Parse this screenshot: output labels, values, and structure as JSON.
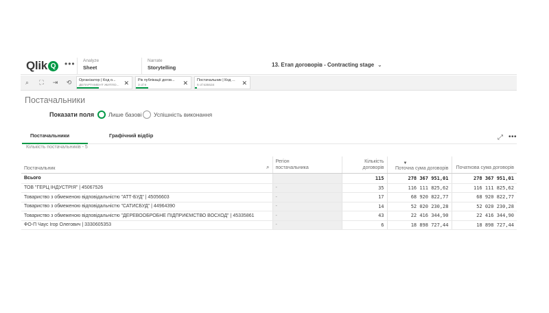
{
  "app": {
    "logo_text": "Qlik",
    "logo_badge": "Q",
    "menu_glyph": "•••",
    "nav": [
      {
        "sub": "Analyze",
        "main": "Sheet"
      },
      {
        "sub": "Narrate",
        "main": "Storytelling"
      }
    ],
    "sheet_title": "13. Етап договорів - Contracting stage",
    "chevron": "⌄"
  },
  "selections": {
    "tools": [
      "⌕",
      "⛶",
      "⇥",
      "⟲"
    ],
    "chips": [
      {
        "field": "Організатор | Код о...",
        "value": "ДЕПАРТАМЕНТ ЖИТЛО...",
        "clear": "✕"
      },
      {
        "field": "Рік публікації догов...",
        "value": "3 of 9",
        "clear": "✕"
      },
      {
        "field": "Постачальник | Код ...",
        "value": "5 of 535534",
        "clear": "✕"
      }
    ]
  },
  "page": {
    "title": "Постачальники",
    "fields_label": "Показати поля",
    "radio_basic": "Лише базові",
    "radio_performance": "Успішність виконання",
    "tabs": [
      "Постачальники",
      "Графічний відбір"
    ],
    "expand_icon": "⤢",
    "more_icon": "•••",
    "count_label": "Кількість постачальників - 5"
  },
  "table": {
    "headers": {
      "supplier": "Постачальник",
      "region": "Регіон постачальника",
      "count": "Кількість договорів",
      "current": "Поточна сума договорів",
      "initial": "Початкова сума договорів"
    },
    "search_glyph": "⌕",
    "sort_glyph": "▼",
    "total": {
      "label": "Всього",
      "count": "115",
      "current": "278 367 951,01",
      "initial": "278 367 951,01"
    },
    "rows": [
      {
        "supplier": "ТОВ \"ГЕРЦ ІНДУСТРІЯ\" | 45067526",
        "region": "-",
        "count": "35",
        "current": "116 111 825,62",
        "initial": "116 111 825,62"
      },
      {
        "supplier": "Товариство з обмеженою відповідальністю \"АТТ-БУД\" | 45056603",
        "region": "-",
        "count": "17",
        "current": "68 920 822,77",
        "initial": "68 920 822,77"
      },
      {
        "supplier": "Товариство з обмеженою відповідальністю \"САТИСБУД\" | 44964390",
        "region": "-",
        "count": "14",
        "current": "52 020 230,28",
        "initial": "52 020 230,28"
      },
      {
        "supplier": "Товариство з обмеженою відповідальністю \"ДЕРЕВООБРОБНЕ ПІДПРИЄМСТВО ВОСХОД\" | 45335861",
        "region": "-",
        "count": "43",
        "current": "22 416 344,90",
        "initial": "22 416 344,90"
      },
      {
        "supplier": "ФО-П Чаус Ігор Олегович | 3330605353",
        "region": "-",
        "count": "6",
        "current": "18 898 727,44",
        "initial": "18 898 727,44"
      }
    ]
  },
  "colors": {
    "accent": "#009845",
    "text": "#404040",
    "muted": "#888888"
  }
}
